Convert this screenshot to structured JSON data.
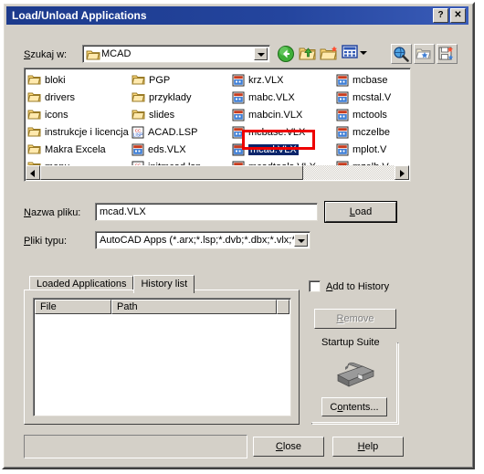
{
  "window": {
    "title": "Load/Unload Applications",
    "help_button": "?",
    "close_button": "✕"
  },
  "toolbar": {
    "lookin_label": "Szukaj w:",
    "lookin_value": "MCAD",
    "nav_icons": [
      "back-arrow-icon",
      "up-one-level-icon",
      "new-folder-icon",
      "views-menu-icon"
    ],
    "right_icons": [
      "search-web-icon",
      "find-file-icon",
      "add-favorite-icon"
    ]
  },
  "file_list": {
    "columns": [
      [
        {
          "name": "bloki",
          "type": "folder"
        },
        {
          "name": "drivers",
          "type": "folder"
        },
        {
          "name": "icons",
          "type": "folder"
        },
        {
          "name": "instrukcje i licencja",
          "type": "folder"
        },
        {
          "name": "Makra Excela",
          "type": "folder"
        },
        {
          "name": "menu",
          "type": "folder"
        }
      ],
      [
        {
          "name": "PGP",
          "type": "folder"
        },
        {
          "name": "przyklady",
          "type": "folder"
        },
        {
          "name": "slides",
          "type": "folder"
        },
        {
          "name": "ACAD.LSP",
          "type": "lsp"
        },
        {
          "name": "eds.VLX",
          "type": "vlx"
        },
        {
          "name": "initmcad.lsp",
          "type": "lsp"
        }
      ],
      [
        {
          "name": "krz.VLX",
          "type": "vlx"
        },
        {
          "name": "mabc.VLX",
          "type": "vlx"
        },
        {
          "name": "mabcin.VLX",
          "type": "vlx"
        },
        {
          "name": "mcbase.VLX",
          "type": "vlx"
        },
        {
          "name": "mcad.VLX",
          "type": "vlx",
          "selected": true
        },
        {
          "name": "mcadtools.VLX",
          "type": "vlx"
        }
      ],
      [
        {
          "name": "mcbase",
          "type": "vlx"
        },
        {
          "name": "mcstal.V",
          "type": "vlx"
        },
        {
          "name": "mctools",
          "type": "vlx"
        },
        {
          "name": "mczelbe",
          "type": "vlx"
        },
        {
          "name": "mplot.V",
          "type": "vlx"
        },
        {
          "name": "mzelb.V",
          "type": "vlx"
        }
      ]
    ],
    "highlight_color": "#ee0000",
    "selection_color": "#0a246a"
  },
  "fields": {
    "filename_label": "Nazwa pliku:",
    "filename_value": "mcad.VLX",
    "filetype_label": "Pliki typu:",
    "filetype_value": "AutoCAD Apps (*.arx;*.lsp;*.dvb;*.dbx;*.vlx;*.",
    "load_button": "Load"
  },
  "tabs": [
    {
      "label": "Loaded Applications",
      "active": false
    },
    {
      "label": "History list",
      "active": true
    }
  ],
  "history_list": {
    "columns": [
      "File",
      "Path"
    ],
    "rows": []
  },
  "right_panel": {
    "add_to_history_label": "Add to History",
    "add_to_history_checked": false,
    "remove_button": "Remove",
    "remove_enabled": false,
    "startup_suite_title": "Startup Suite",
    "startup_suite_icon": "briefcase-icon",
    "contents_button": "Contents..."
  },
  "bottom": {
    "status_text": "",
    "close_button": "Close",
    "help_button": "Help"
  }
}
